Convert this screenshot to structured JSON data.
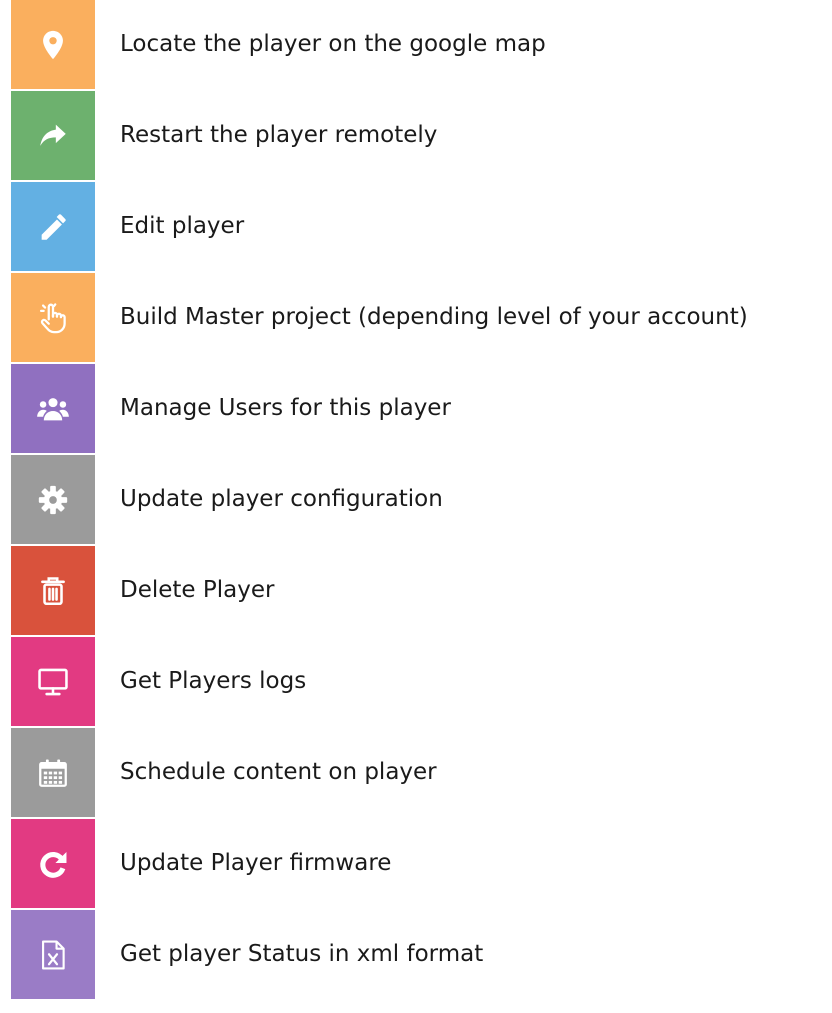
{
  "items": [
    {
      "icon": "map-marker-icon",
      "color": "#FAAF5E",
      "label": "Locate the player on the google map"
    },
    {
      "icon": "share-arrow-icon",
      "color": "#6DB16E",
      "label": "Restart the player remotely"
    },
    {
      "icon": "pencil-icon",
      "color": "#63B0E3",
      "label": "Edit player"
    },
    {
      "icon": "pointing-hand-icon",
      "color": "#FAAF5E",
      "label": "Build Master project (depending level of your account)"
    },
    {
      "icon": "users-group-icon",
      "color": "#9070C0",
      "label": "Manage Users for this player"
    },
    {
      "icon": "gear-icon",
      "color": "#9B9B9B",
      "label": "Update player configuration"
    },
    {
      "icon": "trash-icon",
      "color": "#D9523C",
      "label": "Delete Player"
    },
    {
      "icon": "monitor-icon",
      "color": "#E23A82",
      "label": "Get Players logs"
    },
    {
      "icon": "calendar-icon",
      "color": "#9B9B9B",
      "label": "Schedule content on player"
    },
    {
      "icon": "refresh-icon",
      "color": "#E23A82",
      "label": "Update Player firmware"
    },
    {
      "icon": "xml-file-icon",
      "color": "#9A7CC6",
      "label": "Get player Status in xml format"
    }
  ]
}
